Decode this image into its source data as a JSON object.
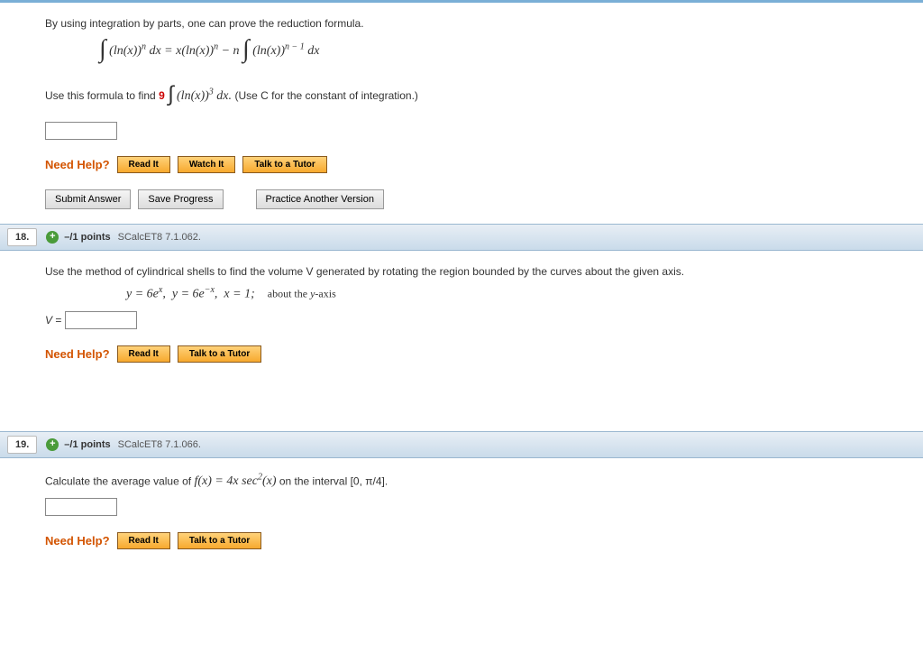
{
  "q17": {
    "intro": "By using integration by parts, one can prove the reduction formula.",
    "use_line_prefix": "Use this formula to find ",
    "use_coef": "9",
    "use_line_suffix": " (Use C for the constant of integration.)",
    "need_help": "Need Help?",
    "read_it": "Read It",
    "watch_it": "Watch It",
    "talk_tutor": "Talk to a Tutor",
    "submit": "Submit Answer",
    "save": "Save Progress",
    "practice": "Practice Another Version"
  },
  "q18": {
    "number": "18.",
    "points": "–/1 points",
    "ref": "SCalcET8 7.1.062.",
    "prompt": "Use the method of cylindrical shells to find the volume V generated by rotating the region bounded by the curves about the given axis.",
    "curves": "y = 6e^x,  y = 6e^{−x},  x = 1;    about the y-axis",
    "v_label": "V = ",
    "need_help": "Need Help?",
    "read_it": "Read It",
    "talk_tutor": "Talk to a Tutor"
  },
  "q19": {
    "number": "19.",
    "points": "–/1 points",
    "ref": "SCalcET8 7.1.066.",
    "prompt_prefix": "Calculate the average value of  ",
    "prompt_func": "f(x) = 4x sec²(x)",
    "prompt_suffix": "  on the interval [0, π/4].",
    "need_help": "Need Help?",
    "read_it": "Read It",
    "talk_tutor": "Talk to a Tutor"
  }
}
